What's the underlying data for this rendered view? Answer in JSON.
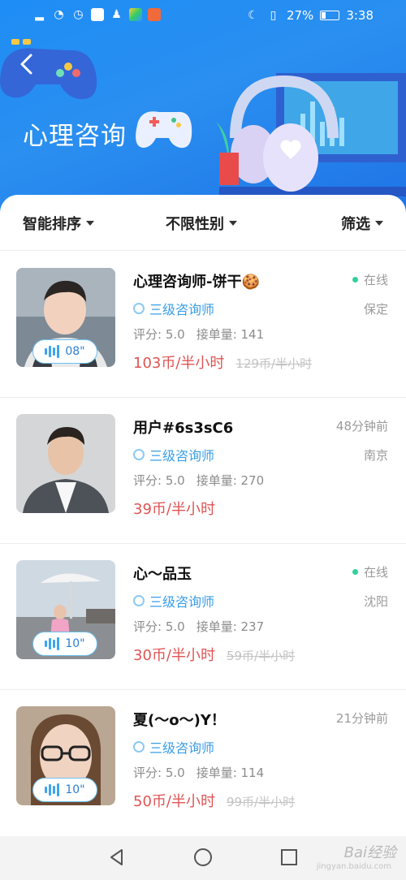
{
  "status_bar": {
    "battery_percent": "27%",
    "battery_level": 0.27,
    "time": "3:38",
    "icons_left": [
      "signal-icon",
      "wifi-icon",
      "alarm-icon",
      "app-icon-qq-blue",
      "qq-penguin-icon",
      "app-icon-colorful",
      "app-icon-red"
    ],
    "icons_right": [
      "moon-icon",
      "vibrate-icon",
      "battery-icon"
    ]
  },
  "header": {
    "title": "心理咨询",
    "back_icon": "chevron-left-icon"
  },
  "filters": {
    "sort_label": "智能排序",
    "gender_label": "不限性别",
    "filter_label": "筛选"
  },
  "counselors": [
    {
      "name": "心理咨询师-饼干🍪",
      "level": "三级咨询师",
      "rating_text": "评分: 5.0",
      "orders_text": "接单量: 141",
      "price": "103币/半小时",
      "old_price": "129币/半小时",
      "status": "在线",
      "online": true,
      "city": "保定",
      "voice_duration": "08\""
    },
    {
      "name": "用户#6s3sC6",
      "level": "三级咨询师",
      "rating_text": "评分: 5.0",
      "orders_text": "接单量: 270",
      "price": "39币/半小时",
      "old_price": "",
      "status": "48分钟前",
      "online": false,
      "city": "南京",
      "voice_duration": ""
    },
    {
      "name": "心～品玉",
      "level": "三级咨询师",
      "rating_text": "评分: 5.0",
      "orders_text": "接单量: 237",
      "price": "30币/半小时",
      "old_price": "59币/半小时",
      "status": "在线",
      "online": true,
      "city": "沈阳",
      "voice_duration": "10\""
    },
    {
      "name": "夏(～o～)Y！",
      "level": "三级咨询师",
      "rating_text": "评分: 5.0",
      "orders_text": "接单量: 114",
      "price": "50币/半小时",
      "old_price": "99币/半小时",
      "status": "21分钟前",
      "online": false,
      "city": "",
      "voice_duration": "10\""
    }
  ],
  "watermark": {
    "text": "Bai经验",
    "sub": "jingyan.baidu.com"
  },
  "colors": {
    "banner_blue": "#1f86f2",
    "level_blue": "#3a9ee8",
    "price_red": "#e05454",
    "online_green": "#32d19c"
  }
}
